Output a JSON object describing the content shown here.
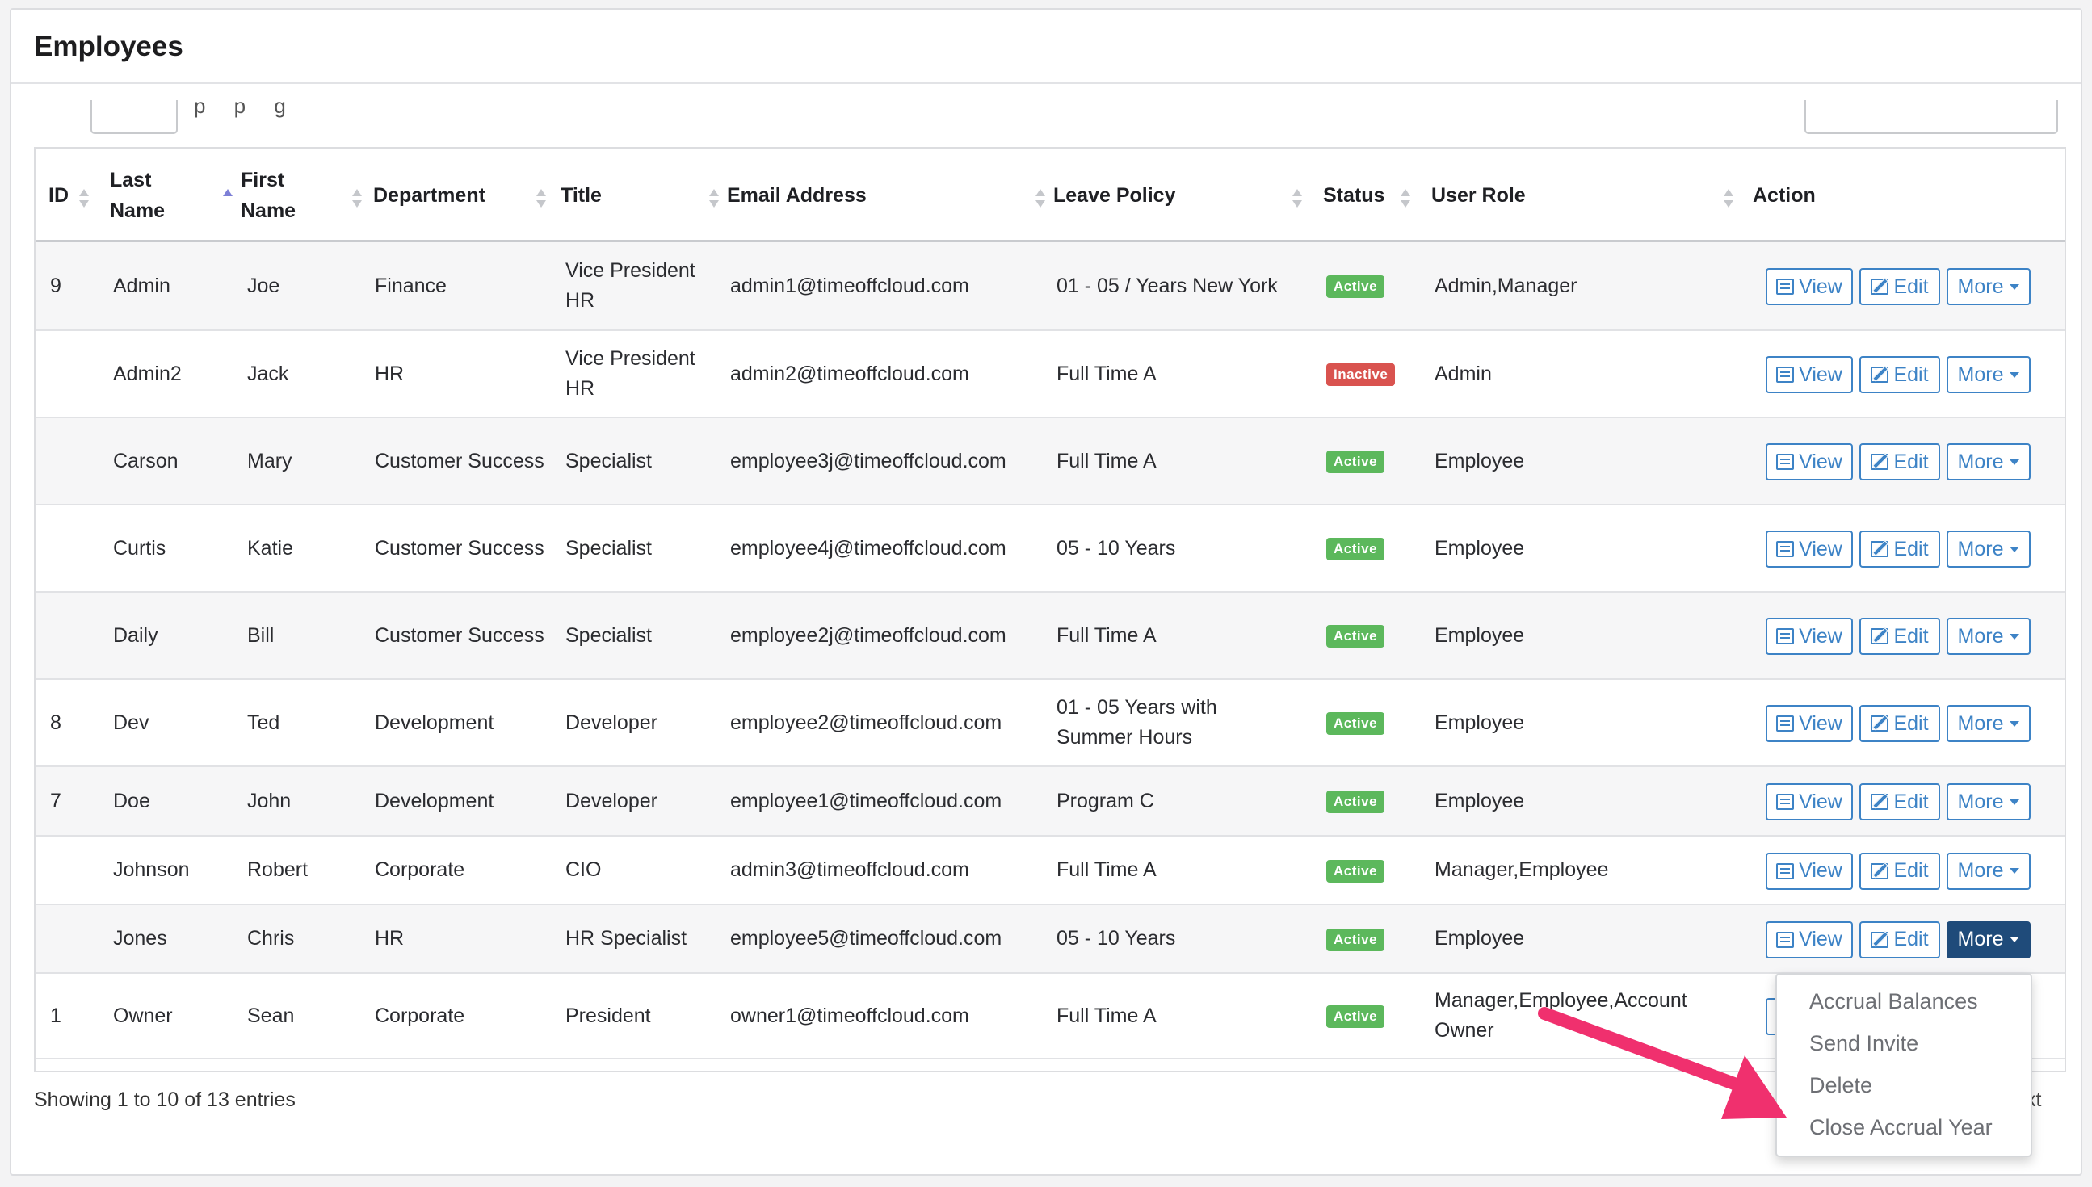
{
  "page_title": "Employees",
  "length_menu_fragment": "p p g",
  "columns": [
    {
      "key": "id",
      "label": "ID"
    },
    {
      "key": "last",
      "label": "Last Name"
    },
    {
      "key": "first",
      "label": "First Name"
    },
    {
      "key": "dept",
      "label": "Department"
    },
    {
      "key": "title",
      "label": "Title"
    },
    {
      "key": "email",
      "label": "Email Address"
    },
    {
      "key": "policy",
      "label": "Leave Policy"
    },
    {
      "key": "status",
      "label": "Status"
    },
    {
      "key": "role",
      "label": "User Role"
    },
    {
      "key": "action",
      "label": "Action"
    }
  ],
  "rows": [
    {
      "id": "9",
      "last": "Admin",
      "first": "Joe",
      "dept": "Finance",
      "title": "Vice President HR",
      "email": "admin1@timeoffcloud.com",
      "policy": "01 - 05 / Years New York",
      "status": "Active",
      "role": "Admin,Manager"
    },
    {
      "id": "",
      "last": "Admin2",
      "first": "Jack",
      "dept": "HR",
      "title": "Vice President HR",
      "email": "admin2@timeoffcloud.com",
      "policy": "Full Time A",
      "status": "Inactive",
      "role": "Admin"
    },
    {
      "id": "",
      "last": "Carson",
      "first": "Mary",
      "dept": "Customer Success",
      "title": "Specialist",
      "email": "employee3j@timeoffcloud.com",
      "policy": "Full Time A",
      "status": "Active",
      "role": "Employee"
    },
    {
      "id": "",
      "last": "Curtis",
      "first": "Katie",
      "dept": "Customer Success",
      "title": "Specialist",
      "email": "employee4j@timeoffcloud.com",
      "policy": "05 - 10 Years",
      "status": "Active",
      "role": "Employee"
    },
    {
      "id": "",
      "last": "Daily",
      "first": "Bill",
      "dept": "Customer Success",
      "title": "Specialist",
      "email": "employee2j@timeoffcloud.com",
      "policy": "Full Time A",
      "status": "Active",
      "role": "Employee"
    },
    {
      "id": "8",
      "last": "Dev",
      "first": "Ted",
      "dept": "Development",
      "title": "Developer",
      "email": "employee2@timeoffcloud.com",
      "policy": "01 - 05 Years with Summer Hours",
      "status": "Active",
      "role": "Employee"
    },
    {
      "id": "7",
      "last": "Doe",
      "first": "John",
      "dept": "Development",
      "title": "Developer",
      "email": "employee1@timeoffcloud.com",
      "policy": "Program C",
      "status": "Active",
      "role": "Employee"
    },
    {
      "id": "",
      "last": "Johnson",
      "first": "Robert",
      "dept": "Corporate",
      "title": "CIO",
      "email": "admin3@timeoffcloud.com",
      "policy": "Full Time A",
      "status": "Active",
      "role": "Manager,Employee"
    },
    {
      "id": "",
      "last": "Jones",
      "first": "Chris",
      "dept": "HR",
      "title": "HR Specialist",
      "email": "employee5@timeoffcloud.com",
      "policy": "05 - 10 Years",
      "status": "Active",
      "role": "Employee"
    },
    {
      "id": "1",
      "last": "Owner",
      "first": "Sean",
      "dept": "Corporate",
      "title": "President",
      "email": "owner1@timeoffcloud.com",
      "policy": "Full Time A",
      "status": "Active",
      "role": "Manager,Employee,Account Owner"
    }
  ],
  "actions": {
    "view": "View",
    "edit": "Edit",
    "more": "More"
  },
  "dropdown_items": [
    "Accrual Balances",
    "Send Invite",
    "Delete",
    "Close Accrual Year"
  ],
  "footer": {
    "info": "Showing 1 to 10 of 13 entries",
    "next_fragment": "xt"
  },
  "colors": {
    "active": "#5cb85c",
    "inactive": "#d9534f",
    "primary": "#3d83c6",
    "annotation": "#f0306e"
  }
}
